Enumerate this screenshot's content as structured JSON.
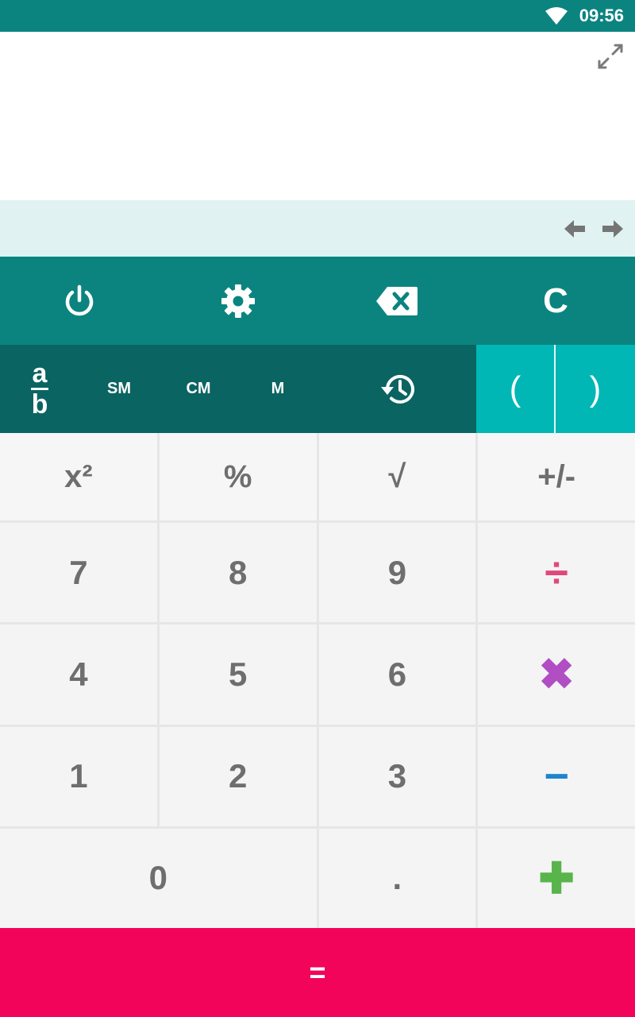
{
  "status": {
    "time": "09:56"
  },
  "icons": {
    "wifi": "wifi-icon",
    "expand": "fullscreen-icon",
    "arrow_left": "arrow-left-icon",
    "arrow_right": "arrow-right-icon",
    "power": "power-icon",
    "settings": "gear-icon",
    "backspace": "backspace-icon",
    "history": "history-icon"
  },
  "toolbar": {
    "clear": "C"
  },
  "memory": {
    "fraction": {
      "numerator": "a",
      "denominator": "b"
    },
    "sm": "SM",
    "cm": "CM",
    "m": "M",
    "paren_open": "(",
    "paren_close": ")"
  },
  "keys": {
    "square": "x²",
    "percent": "%",
    "sqrt": "√",
    "sign": "+/-",
    "k7": "7",
    "k8": "8",
    "k9": "9",
    "divide": "÷",
    "k4": "4",
    "k5": "5",
    "k6": "6",
    "multiply": "✖",
    "k1": "1",
    "k2": "2",
    "k3": "3",
    "subtract": "−",
    "k0": "0",
    "decimal": ".",
    "add": "✚",
    "equals": "="
  },
  "colors": {
    "teal": "#0b8480",
    "teal_dark": "#0a6462",
    "cyan": "#00b7b5",
    "history_bg": "#e0f2f1",
    "equals_bg": "#f2045a",
    "divide": "#e0487c",
    "multiply": "#b14ec3",
    "subtract": "#1f84d0",
    "add": "#59b44c"
  }
}
